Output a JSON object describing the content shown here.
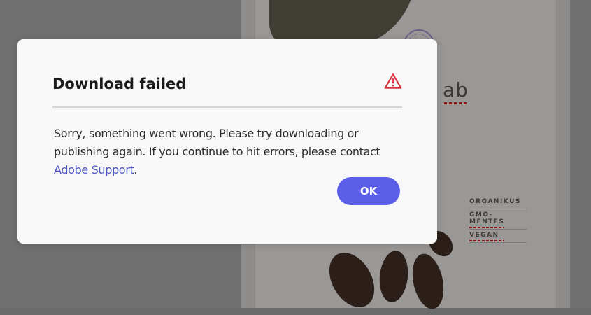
{
  "dialog": {
    "title": "Download failed",
    "message_text": "Sorry, something went wrong. Please try downloading or publishing again. If you continue to hit errors, please contact ",
    "link_text": "Adobe Support",
    "message_end": ".",
    "ok_label": "OK",
    "icon": "warning-triangle-icon"
  },
  "background": {
    "title_fragment": "ab",
    "tags": [
      "ORGANIKUS",
      "GMO-MENTES",
      "VEGAN"
    ]
  },
  "colors": {
    "accent": "#5a5ee8",
    "link": "#4f55c8",
    "warning": "#d7373f",
    "dialog_background": "#f8f8f8"
  }
}
